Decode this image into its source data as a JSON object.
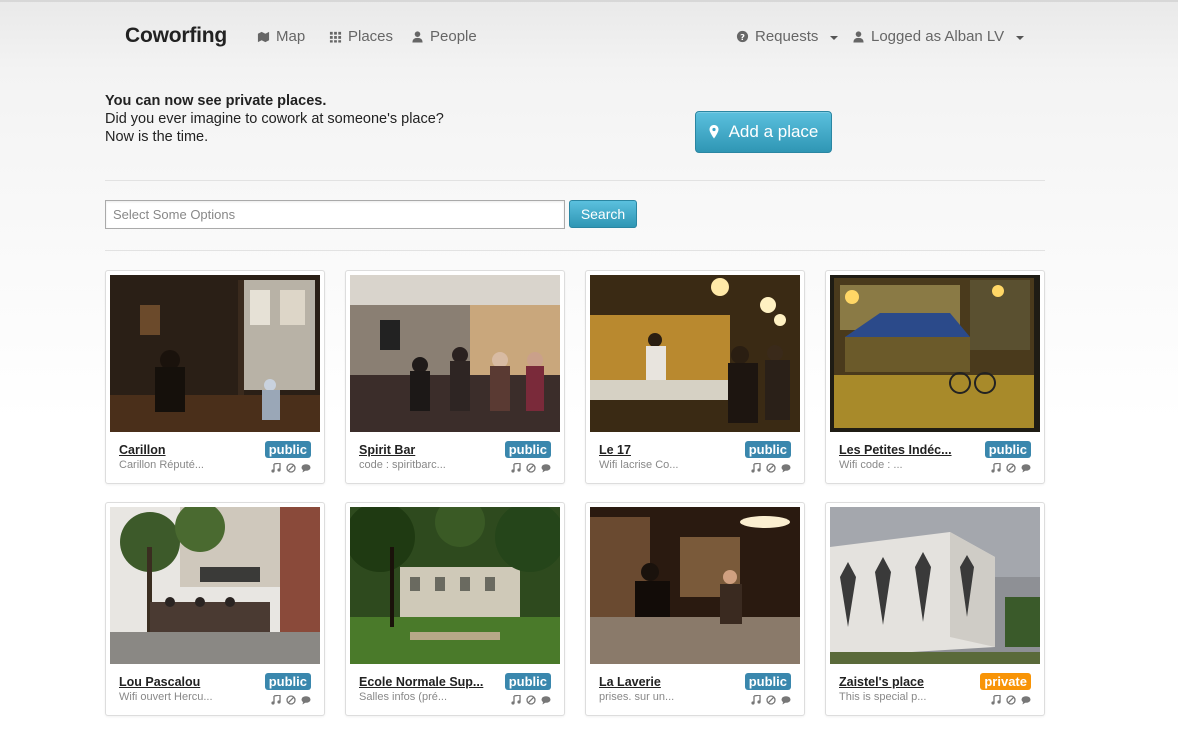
{
  "navbar": {
    "brand": "Coworfing",
    "items": [
      {
        "label": "Map",
        "icon": "map-icon"
      },
      {
        "label": "Places",
        "icon": "grid-icon"
      },
      {
        "label": "People",
        "icon": "user-icon"
      }
    ],
    "requests": {
      "label": "Requests",
      "icon": "question-circle-icon"
    },
    "account": {
      "label": "Logged as Alban LV",
      "icon": "user-icon"
    }
  },
  "hero": {
    "line1": "You can now see private places.",
    "line2": "Did you ever imagine to cowork at someone's place?",
    "line3": "Now is the time.",
    "add_button": "Add a place"
  },
  "search": {
    "placeholder": "Select Some Options",
    "button": "Search"
  },
  "colors": {
    "accent": "#2f96b4",
    "public_badge": "#3a87ad",
    "private_badge": "#f89406"
  },
  "places": [
    {
      "name": "Carillon",
      "desc": "Carillon Réputé...",
      "badge": "public",
      "icons": [
        "music-icon",
        "no-smoking-icon",
        "comment-icon"
      ]
    },
    {
      "name": "Spirit Bar",
      "desc": "code : spiritbarc...",
      "badge": "public",
      "icons": [
        "music-icon",
        "no-smoking-icon",
        "comment-icon"
      ]
    },
    {
      "name": "Le 17",
      "desc": "Wifi lacrise Co...",
      "badge": "public",
      "icons": [
        "music-icon",
        "no-smoking-icon",
        "comment-icon"
      ]
    },
    {
      "name": "Les Petites Indéc...",
      "desc": "Wifi code : ...",
      "badge": "public",
      "icons": [
        "music-icon",
        "no-smoking-icon",
        "comment-icon"
      ]
    },
    {
      "name": "Lou Pascalou",
      "desc": "Wifi ouvert Hercu...",
      "badge": "public",
      "icons": [
        "music-icon",
        "no-smoking-icon",
        "comment-icon"
      ]
    },
    {
      "name": "Ecole Normale Sup...",
      "desc": "Salles infos (pré...",
      "badge": "public",
      "icons": [
        "music-icon",
        "no-smoking-icon",
        "comment-icon"
      ]
    },
    {
      "name": "La Laverie",
      "desc": "prises. sur un...",
      "badge": "public",
      "icons": [
        "music-icon",
        "no-smoking-icon",
        "comment-icon"
      ]
    },
    {
      "name": "Zaistel's place",
      "desc": "This is special p...",
      "badge": "private",
      "icons": [
        "music-icon",
        "no-smoking-icon",
        "comment-icon"
      ]
    }
  ]
}
